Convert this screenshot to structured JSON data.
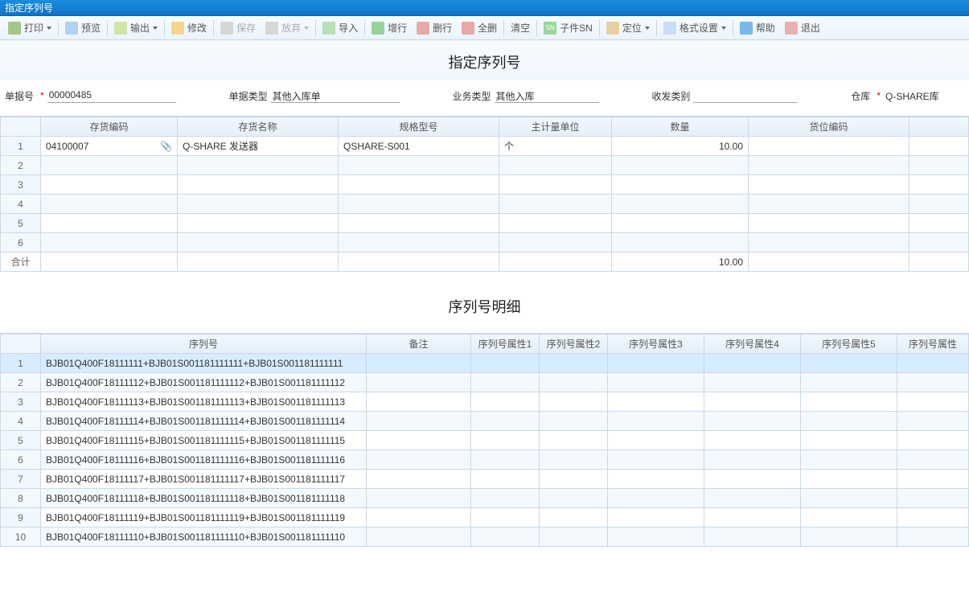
{
  "window": {
    "title": "指定序列号"
  },
  "toolbar": {
    "print": "打印",
    "preview": "预览",
    "export": "输出",
    "edit": "修改",
    "save": "保存",
    "discard": "放弃",
    "import": "导入",
    "addrow": "增行",
    "delrow": "删行",
    "delall": "全删",
    "clear": "清空",
    "subsn": "子件SN",
    "locate": "定位",
    "format": "格式设置",
    "help": "帮助",
    "exit": "退出",
    "sn_badge": "SN"
  },
  "header": {
    "page_title": "指定序列号",
    "bill_no_label": "单据号",
    "bill_no": "00000485",
    "bill_type_label": "单据类型",
    "bill_type": "其他入库单",
    "biz_type_label": "业务类型",
    "biz_type": "其他入库",
    "sf_type_label": "收发类别",
    "sf_type": "",
    "wh_label": "仓库",
    "wh": "Q-SHARE库"
  },
  "grid1": {
    "cols": [
      "存货编码",
      "存货名称",
      "规格型号",
      "主计量单位",
      "数量",
      "货位编码"
    ],
    "rows": [
      {
        "n": "1",
        "code": "04100007",
        "name": "Q-SHARE 发送器",
        "spec": "QSHARE-S001",
        "unit": "个",
        "qty": "10.00",
        "bin": ""
      },
      {
        "n": "2"
      },
      {
        "n": "3"
      },
      {
        "n": "4"
      },
      {
        "n": "5"
      },
      {
        "n": "6"
      }
    ],
    "total_label": "合计",
    "total_qty": "10.00"
  },
  "detail_title": "序列号明细",
  "grid2": {
    "cols": [
      "序列号",
      "备注",
      "序列号属性1",
      "序列号属性2",
      "序列号属性3",
      "序列号属性4",
      "序列号属性5",
      "序列号属性"
    ],
    "rows": [
      {
        "n": "1",
        "sn": "BJB01Q400F18111111+BJB01S001181111111+BJB01S001181111111"
      },
      {
        "n": "2",
        "sn": "BJB01Q400F18111112+BJB01S001181111112+BJB01S001181111112"
      },
      {
        "n": "3",
        "sn": "BJB01Q400F18111113+BJB01S001181111113+BJB01S001181111113"
      },
      {
        "n": "4",
        "sn": "BJB01Q400F18111114+BJB01S001181111114+BJB01S001181111114"
      },
      {
        "n": "5",
        "sn": "BJB01Q400F18111115+BJB01S001181111115+BJB01S001181111115"
      },
      {
        "n": "6",
        "sn": "BJB01Q400F18111116+BJB01S001181111116+BJB01S001181111116"
      },
      {
        "n": "7",
        "sn": "BJB01Q400F18111117+BJB01S001181111117+BJB01S001181111117"
      },
      {
        "n": "8",
        "sn": "BJB01Q400F18111118+BJB01S001181111118+BJB01S001181111118"
      },
      {
        "n": "9",
        "sn": "BJB01Q400F18111119+BJB01S001181111119+BJB01S001181111119"
      },
      {
        "n": "10",
        "sn": "BJB01Q400F18111110+BJB01S001181111110+BJB01S001181111110"
      }
    ]
  }
}
